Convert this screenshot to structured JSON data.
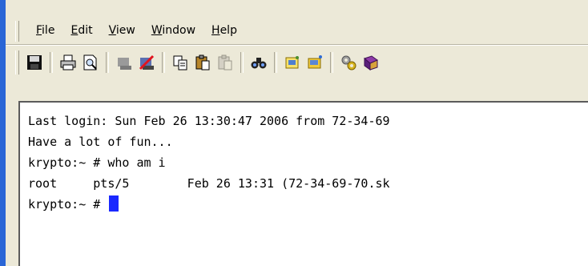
{
  "menu": {
    "items": [
      {
        "mnemonic": "F",
        "rest": "ile"
      },
      {
        "mnemonic": "E",
        "rest": "dit"
      },
      {
        "mnemonic": "V",
        "rest": "iew"
      },
      {
        "mnemonic": "W",
        "rest": "indow"
      },
      {
        "mnemonic": "H",
        "rest": "elp"
      }
    ]
  },
  "toolbar": {
    "icons": [
      "save-icon",
      "print-icon",
      "print-preview-icon",
      "connect-icon",
      "disconnect-icon",
      "copy-icon",
      "paste-icon",
      "paste-disabled-icon",
      "find-icon",
      "session-icon",
      "session-open-icon",
      "settings-icon",
      "help-book-icon"
    ]
  },
  "terminal": {
    "lines": [
      "Last login: Sun Feb 26 13:30:47 2006 from 72-34-69",
      "Have a lot of fun...",
      "krypto:~ # who am i",
      "root     pts/5        Feb 26 13:31 (72-34-69-70.sk",
      "krypto:~ # "
    ],
    "cursor_color": "#1a28ff"
  }
}
